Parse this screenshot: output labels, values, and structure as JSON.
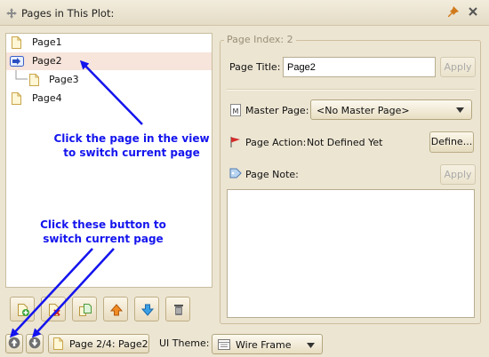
{
  "window": {
    "title": "Pages in This Plot:"
  },
  "tree": {
    "items": [
      {
        "label": "Page1",
        "selected": false,
        "indent": 0,
        "icon": "page-icon"
      },
      {
        "label": "Page2",
        "selected": true,
        "indent": 0,
        "icon": "current-page-arrow-icon"
      },
      {
        "label": "Page3",
        "selected": false,
        "indent": 1,
        "icon": "page-icon"
      },
      {
        "label": "Page4",
        "selected": false,
        "indent": 0,
        "icon": "page-icon"
      }
    ]
  },
  "toolbar": {
    "buttons": [
      "add-page-icon",
      "delete-page-icon",
      "copy-page-icon",
      "move-up-icon",
      "move-down-icon",
      "trash-icon"
    ]
  },
  "details": {
    "page_index": "Page Index: 2",
    "page_title_label": "Page Title:",
    "page_title_value": "Page2",
    "apply_label": "Apply",
    "master_page_label": "Master Page:",
    "master_page_value": "<No Master Page>",
    "page_action_label": "Page Action:",
    "page_action_value": "Not Defined Yet",
    "define_label": "Define...",
    "page_note_label": "Page Note:",
    "apply_note_label": "Apply"
  },
  "bottom": {
    "page_indicator": "Page 2/4: Page2",
    "theme_label": "UI Theme:",
    "theme_value": "Wire Frame"
  },
  "annotations": {
    "view_hint_line1": "Click the page in the view",
    "view_hint_line2": "to switch current page",
    "button_hint_line1": "Click these button to",
    "button_hint_line2": "switch current page"
  },
  "colors": {
    "annotation": "#1414ee",
    "selection": "#f7e4da",
    "background": "#ece5d2"
  }
}
